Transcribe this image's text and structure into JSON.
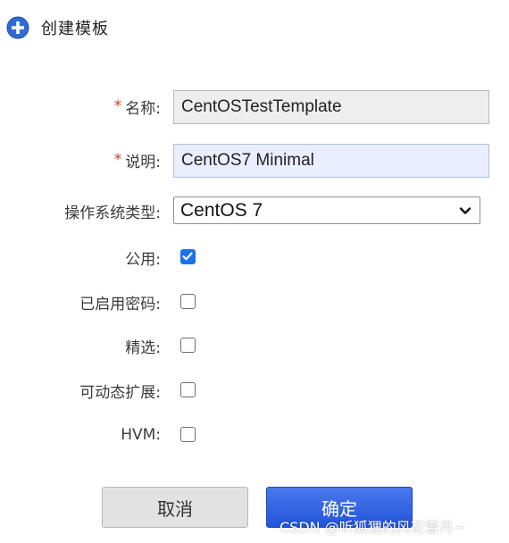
{
  "header": {
    "title": "创建模板",
    "icon": "add-circle-icon",
    "icon_color": "#2f6bd6"
  },
  "form": {
    "required_mark": "*",
    "name": {
      "label": "名称:",
      "value": "CentOSTestTemplate"
    },
    "description": {
      "label": "说明:",
      "value": "CentOS7 Minimal"
    },
    "os_type": {
      "label": "操作系统类型:",
      "value": "CentOS 7"
    },
    "public": {
      "label": "公用:",
      "checked": true
    },
    "password_enabled": {
      "label": "已启用密码:",
      "checked": false
    },
    "featured": {
      "label": "精选:",
      "checked": false
    },
    "scalable": {
      "label": "可动态扩展:",
      "checked": false
    },
    "hvm": {
      "label": "HVM:",
      "checked": false
    }
  },
  "buttons": {
    "cancel_label": "取消",
    "ok_label": "确定"
  },
  "watermark": "CSDN @听狐狸的风花雪月~",
  "colors": {
    "accent": "#1a73e8",
    "required": "#e0341c",
    "primary_button": "#2f5fe0"
  }
}
